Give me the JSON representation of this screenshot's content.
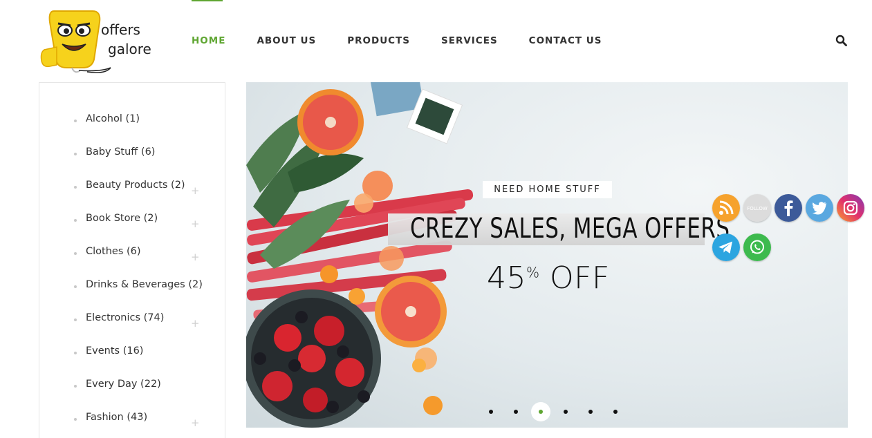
{
  "brand": {
    "logo_line1": "offers",
    "logo_line2": "galore"
  },
  "nav": {
    "items": [
      {
        "label": "HOME",
        "active": true
      },
      {
        "label": "ABOUT US",
        "active": false
      },
      {
        "label": "PRODUCTS",
        "active": false
      },
      {
        "label": "SERVICES",
        "active": false
      },
      {
        "label": "CONTACT US",
        "active": false
      }
    ]
  },
  "sidebar": {
    "categories": [
      {
        "label": "Alcohol (1)",
        "expandable": false
      },
      {
        "label": "Baby Stuff (6)",
        "expandable": false
      },
      {
        "label": "Beauty Products (2)",
        "expandable": true
      },
      {
        "label": "Book Store (2)",
        "expandable": true
      },
      {
        "label": "Clothes (6)",
        "expandable": true
      },
      {
        "label": "Drinks & Beverages (2)",
        "expandable": false
      },
      {
        "label": "Electronics (74)",
        "expandable": true
      },
      {
        "label": "Events (16)",
        "expandable": false
      },
      {
        "label": "Every Day (22)",
        "expandable": false
      },
      {
        "label": "Fashion (43)",
        "expandable": true
      }
    ],
    "expand_symbol": "+"
  },
  "hero": {
    "badge": "NEED HOME STUFF",
    "headline": "CREZY SALES, MEGA OFFERS",
    "offer_number": "45",
    "offer_percent": "%",
    "offer_word": "OFF",
    "slides_total": 6,
    "active_slide": 3
  },
  "social": {
    "icons": [
      "rss-icon",
      "follow-icon",
      "facebook-icon",
      "twitter-icon",
      "instagram-icon",
      "telegram-icon",
      "whatsapp-icon"
    ],
    "follow_label": "FOLLOW"
  },
  "colors": {
    "accent": "#5fa632",
    "text": "#333333"
  }
}
